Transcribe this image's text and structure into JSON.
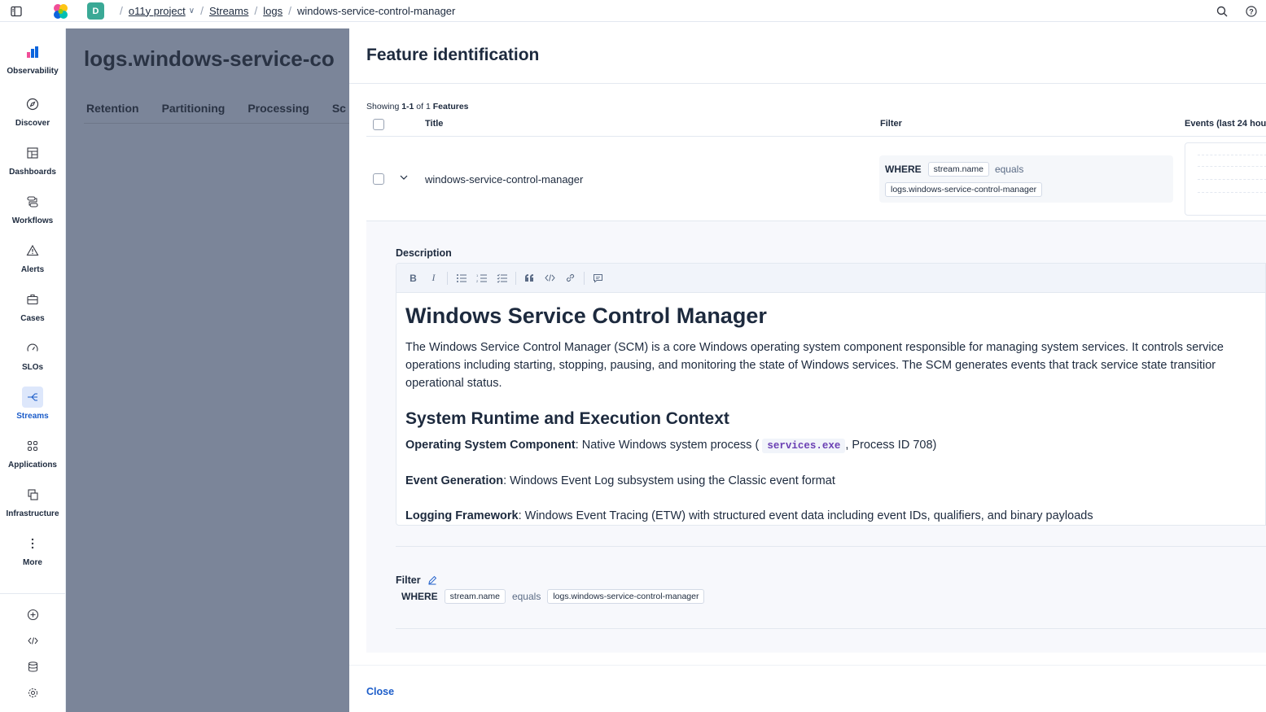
{
  "topbar": {
    "avatar_letter": "D",
    "breadcrumbs": [
      "o11y project",
      "Streams",
      "logs",
      "windows-service-control-manager"
    ]
  },
  "nav": {
    "items": [
      {
        "label": "Observability",
        "icon": "observability-icon"
      },
      {
        "label": "Discover",
        "icon": "compass-icon"
      },
      {
        "label": "Dashboards",
        "icon": "dashboard-icon"
      },
      {
        "label": "Workflows",
        "icon": "workflow-icon"
      },
      {
        "label": "Alerts",
        "icon": "warning-icon"
      },
      {
        "label": "Cases",
        "icon": "briefcase-icon"
      },
      {
        "label": "SLOs",
        "icon": "gauge-icon"
      },
      {
        "label": "Streams",
        "icon": "streams-icon",
        "active": true
      },
      {
        "label": "Applications",
        "icon": "apps-grid-icon"
      },
      {
        "label": "Infrastructure",
        "icon": "infrastructure-icon"
      },
      {
        "label": "More",
        "icon": "more-vertical-icon"
      }
    ],
    "bottom_icons": [
      "plus-circle-icon",
      "code-icon",
      "database-icon",
      "gear-icon"
    ],
    "accent": "#1b5cc9"
  },
  "background_page": {
    "title": "logs.windows-service-co",
    "tabs": [
      "Retention",
      "Partitioning",
      "Processing",
      "Sc"
    ]
  },
  "flyout": {
    "title": "Feature identification",
    "showing_prefix": "Showing ",
    "showing_range": "1-1",
    "showing_mid": " of ",
    "showing_count": "1",
    "showing_suffix": " Features",
    "columns": {
      "title": "Title",
      "filter": "Filter",
      "events": "Events (last 24 hou"
    },
    "row": {
      "title": "windows-service-control-manager",
      "filter": {
        "where": "WHERE",
        "field": "stream.name",
        "op": "equals",
        "value": "logs.windows-service-control-manager"
      }
    },
    "description_label": "Description",
    "toolbar": [
      "B",
      "I",
      "bulleted-list-icon",
      "numbered-list-icon",
      "checklist-icon",
      "quote-icon",
      "code-icon",
      "link-icon",
      "comment-icon"
    ],
    "doc": {
      "h1": "Windows Service Control Manager",
      "p1_line1": "The Windows Service Control Manager (SCM) is a core Windows operating system component responsible for managing system services. It controls service",
      "p1_line2": "operations including starting, stopping, pausing, and monitoring the state of Windows services. The SCM generates events that track service state transitior",
      "p1_line3": "operational status.",
      "h2": "System Runtime and Execution Context",
      "kv1_key": "Operating System Component",
      "kv1_pre": ": Native Windows system process (",
      "kv1_code": "services.exe",
      "kv1_post": ", Process ID 708)",
      "kv2_key": "Event Generation",
      "kv2_val": ": Windows Event Log subsystem using the Classic event format",
      "kv3_key": "Logging Framework",
      "kv3_val": ": Windows Event Tracing (ETW) with structured event data including event IDs, qualifiers, and binary payloads"
    },
    "filter_label": "Filter",
    "close_label": "Close"
  }
}
